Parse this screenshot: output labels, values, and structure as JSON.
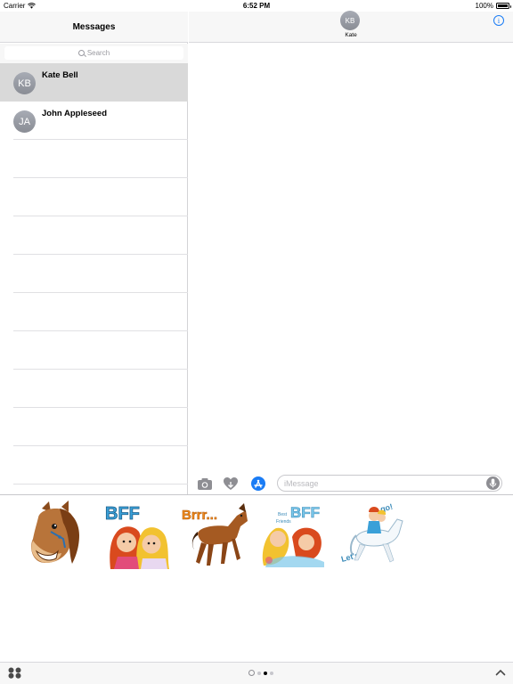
{
  "status_bar": {
    "carrier": "Carrier",
    "time": "6:52 PM",
    "battery": "100%",
    "battery_level": 1.0
  },
  "left_pane": {
    "title": "Messages",
    "search_placeholder": "Search",
    "conversations": [
      {
        "initials": "KB",
        "name": "Kate Bell",
        "selected": true
      },
      {
        "initials": "JA",
        "name": "John Appleseed",
        "selected": false
      }
    ]
  },
  "right_header": {
    "initials": "KB",
    "name": "Kate"
  },
  "input_bar": {
    "placeholder": "iMessage"
  },
  "stickers": [
    {
      "icon": "horse-head-sticker"
    },
    {
      "icon": "bff-girls-sticker",
      "text": "BFF"
    },
    {
      "icon": "brrr-horse-sticker",
      "text": "Brrr..."
    },
    {
      "icon": "best-friends-sticker",
      "text": "BFF"
    },
    {
      "icon": "lets-go-horse-sticker",
      "text": "Let's go!"
    }
  ],
  "colors": {
    "accent": "#1a7cf5",
    "selected_row": "#d9d9d9",
    "avatar": "#9a9da5"
  }
}
